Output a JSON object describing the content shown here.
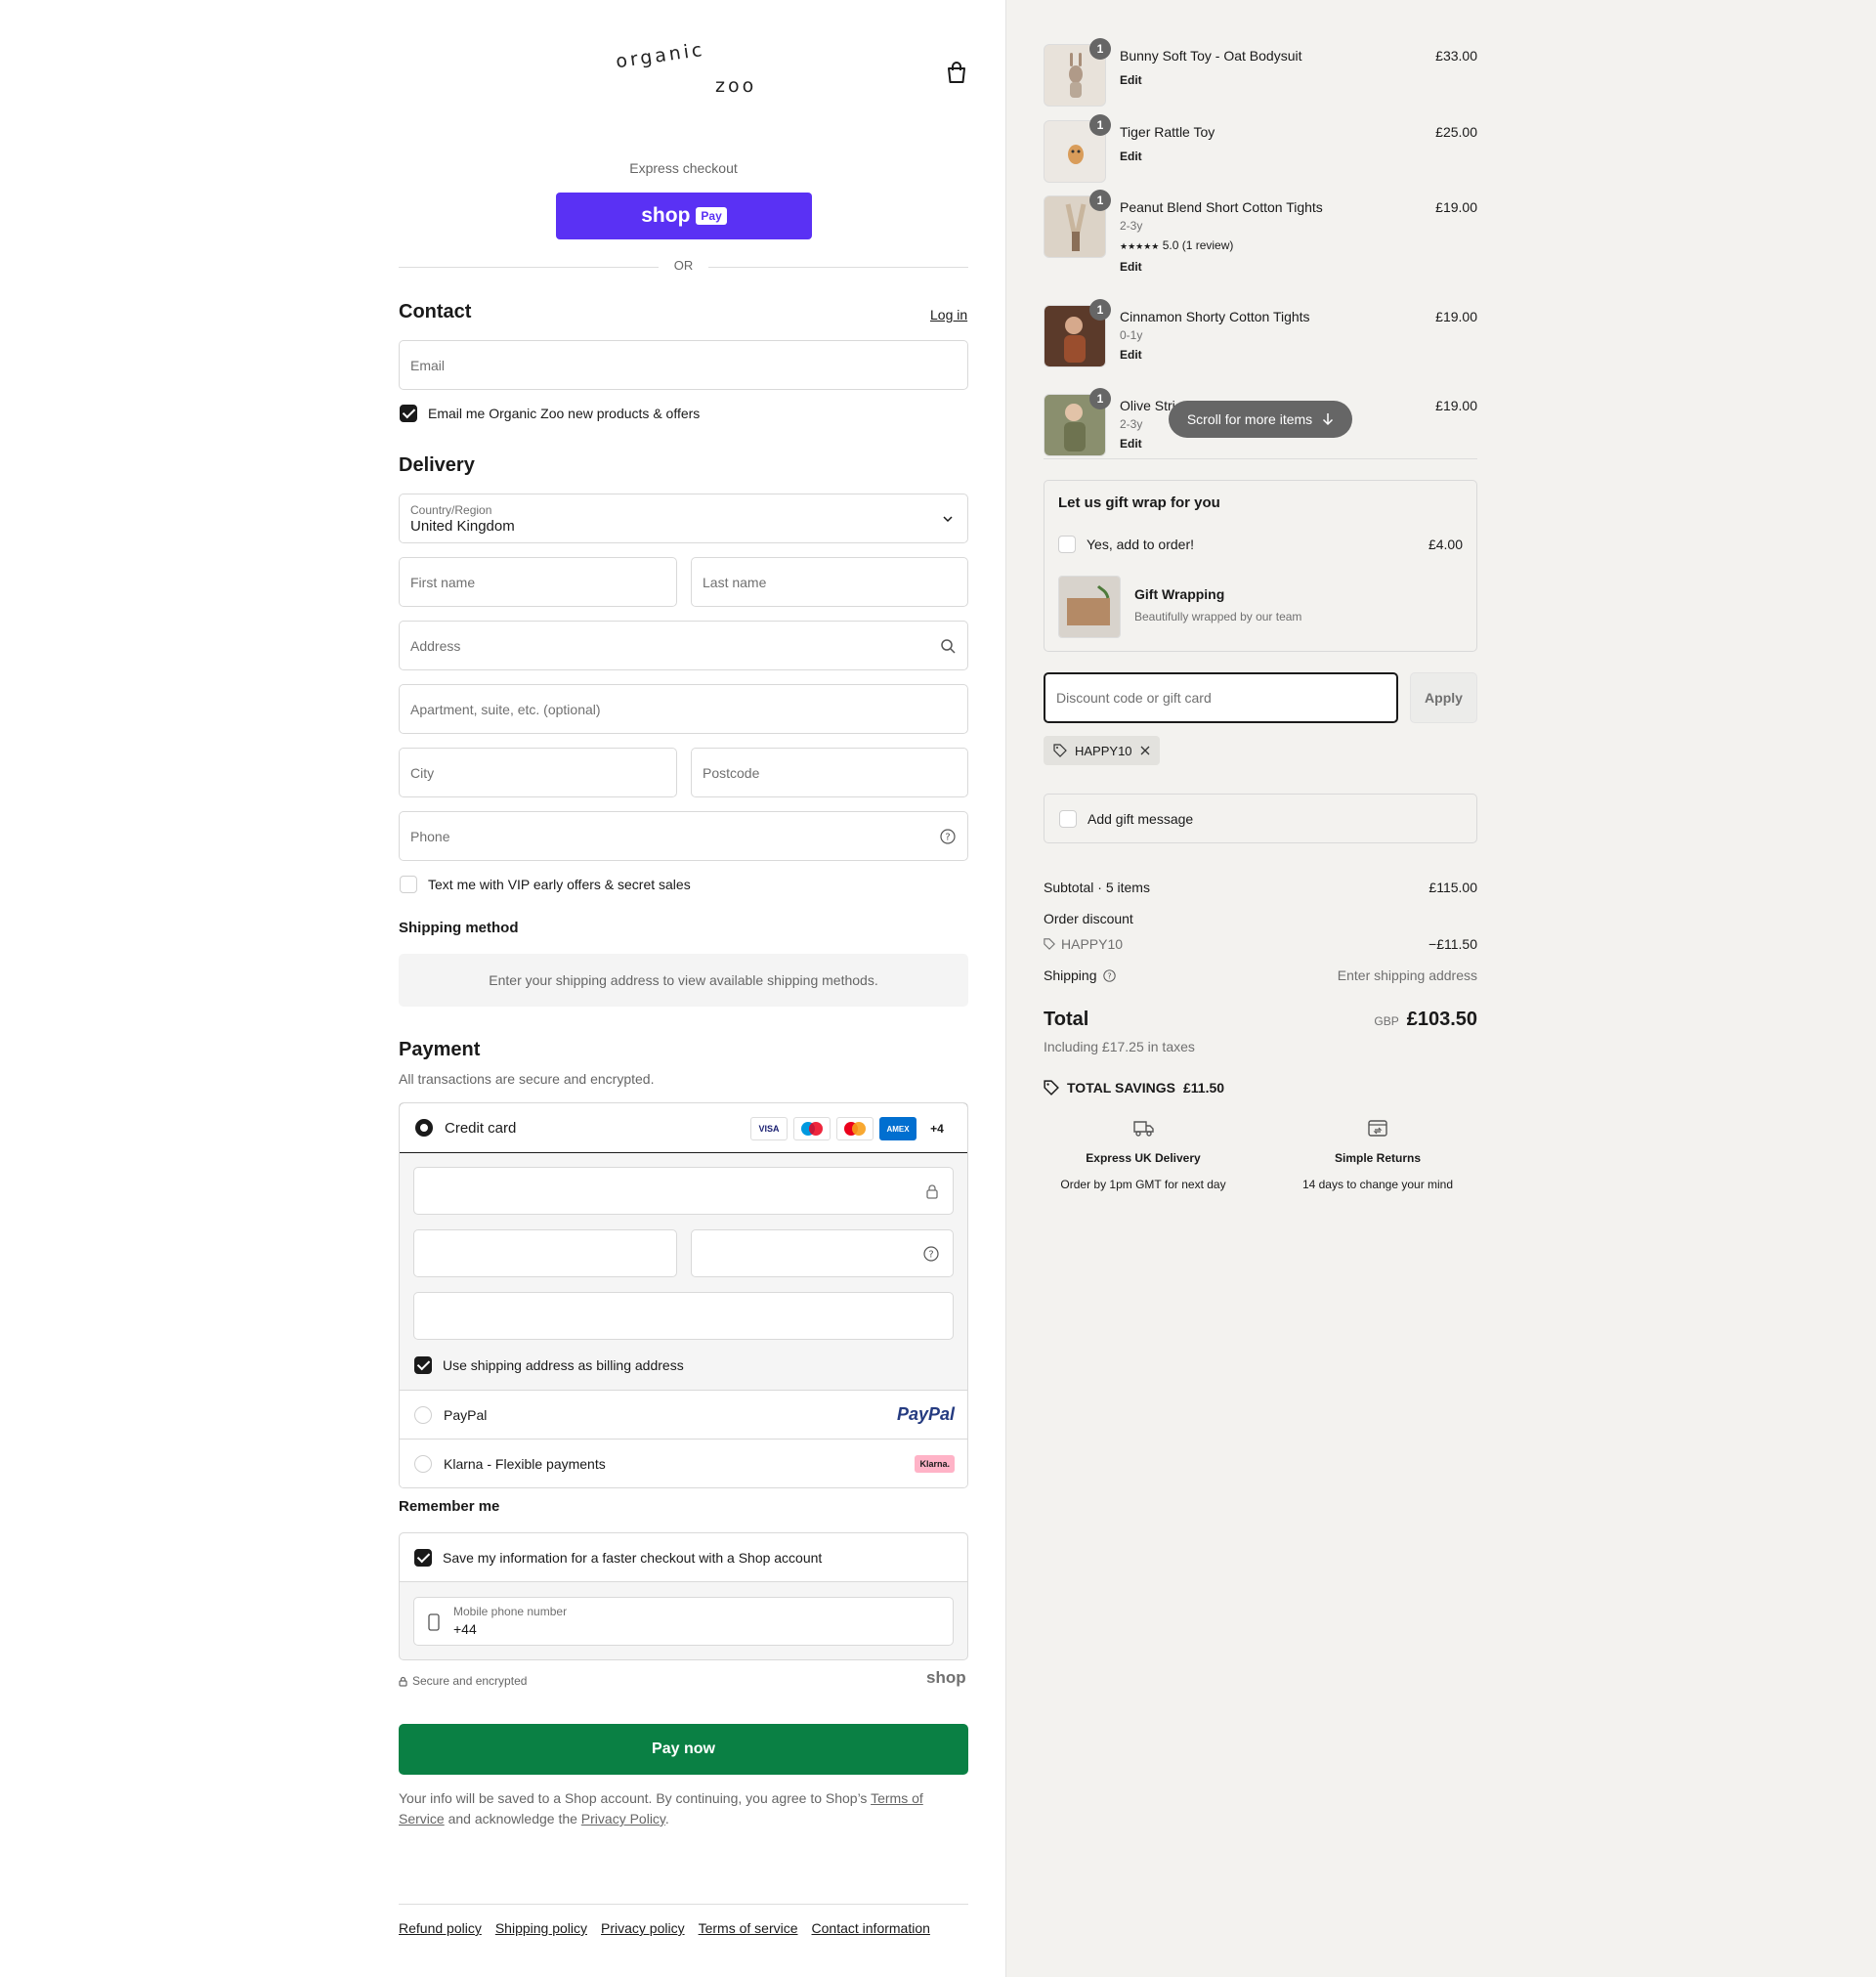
{
  "brand": {
    "logo_top": "organic",
    "logo_bottom": "zoo"
  },
  "express": {
    "label": "Express checkout",
    "shop_label": "shop",
    "pay_label": "Pay",
    "or": "OR"
  },
  "contact": {
    "title": "Contact",
    "login": "Log in",
    "email_placeholder": "Email",
    "newsletter": "Email me Organic Zoo new products & offers",
    "newsletter_checked": true
  },
  "delivery": {
    "title": "Delivery",
    "country_label": "Country/Region",
    "country_value": "United Kingdom",
    "first_name": "First name",
    "last_name": "Last name",
    "address": "Address",
    "apartment": "Apartment, suite, etc. (optional)",
    "city": "City",
    "postcode": "Postcode",
    "phone": "Phone",
    "sms": "Text me with VIP early offers & secret sales",
    "sms_checked": false
  },
  "shipping": {
    "title": "Shipping method",
    "message": "Enter your shipping address to view available shipping methods."
  },
  "payment": {
    "title": "Payment",
    "subtitle": "All transactions are secure and encrypted.",
    "credit_card": "Credit card",
    "more_cards": "+4",
    "cards": [
      "VISA",
      "Maestro",
      "Mastercard",
      "AMEX"
    ],
    "billing": "Use shipping address as billing address",
    "paypal": "PayPal",
    "paypal_logo": "PayPal",
    "klarna": "Klarna - Flexible payments",
    "klarna_logo": "Klarna."
  },
  "remember": {
    "title": "Remember me",
    "save": "Save my information for a faster checkout with a Shop account",
    "phone_label": "Mobile phone number",
    "phone_value": "+44",
    "secure": "Secure and encrypted",
    "shop_logo": "shop"
  },
  "paynow": "Pay now",
  "legal": {
    "prefix": "Your info will be saved to a Shop account. By continuing, you agree to Shop’s ",
    "terms": "Terms of Service",
    "middle": " and acknowledge the ",
    "privacy": "Privacy Policy",
    "suffix": "."
  },
  "footer": [
    "Refund policy",
    "Shipping policy",
    "Privacy policy",
    "Terms of service",
    "Contact information"
  ],
  "cart": {
    "items": [
      {
        "qty": "1",
        "name": "Bunny Soft Toy - Oat Bodysuit",
        "variant": "",
        "rating": "",
        "edit": "Edit",
        "price": "£33.00"
      },
      {
        "qty": "1",
        "name": "Tiger Rattle Toy",
        "variant": "",
        "rating": "",
        "edit": "Edit",
        "price": "£25.00"
      },
      {
        "qty": "1",
        "name": "Peanut Blend Short Cotton Tights",
        "variant": "2-3y",
        "rating": "5.0 (1 review)",
        "edit": "Edit",
        "price": "£19.00"
      },
      {
        "qty": "1",
        "name": "Cinnamon Shorty Cotton Tights",
        "variant": "0-1y",
        "rating": "",
        "edit": "Edit",
        "price": "£19.00"
      },
      {
        "qty": "1",
        "name": "Olive Stri",
        "variant": "2-3y",
        "rating": "",
        "edit": "Edit",
        "price": "£19.00"
      }
    ],
    "scroll_hint": "Scroll for more items"
  },
  "giftwrap": {
    "title": "Let us gift wrap for you",
    "option": "Yes, add to order!",
    "price": "£4.00",
    "product": "Gift Wrapping",
    "desc": "Beautifully wrapped by our team"
  },
  "discount": {
    "placeholder": "Discount code or gift card",
    "apply": "Apply",
    "code": "HAPPY10"
  },
  "gift_message": "Add gift message",
  "summary": {
    "subtotal_label": "Subtotal · 5 items",
    "subtotal": "£115.00",
    "discount_label": "Order discount",
    "discount_code": "HAPPY10",
    "discount_value": "−£11.50",
    "shipping_label": "Shipping",
    "shipping_value": "Enter shipping address",
    "total_label": "Total",
    "currency": "GBP",
    "total": "£103.50",
    "taxes": "Including £17.25 in taxes",
    "savings_label": "TOTAL SAVINGS",
    "savings": "£11.50"
  },
  "features": [
    {
      "icon": "delivery-truck-icon",
      "title": "Express UK Delivery",
      "sub": "Order by 1pm GMT for next day"
    },
    {
      "icon": "returns-box-icon",
      "title": "Simple Returns",
      "sub": "14 days to change your mind"
    }
  ],
  "colors": {
    "shop_pay": "#5a31f4",
    "pay_now": "#0a8044",
    "sidebar_bg": "#f3f2ef"
  }
}
